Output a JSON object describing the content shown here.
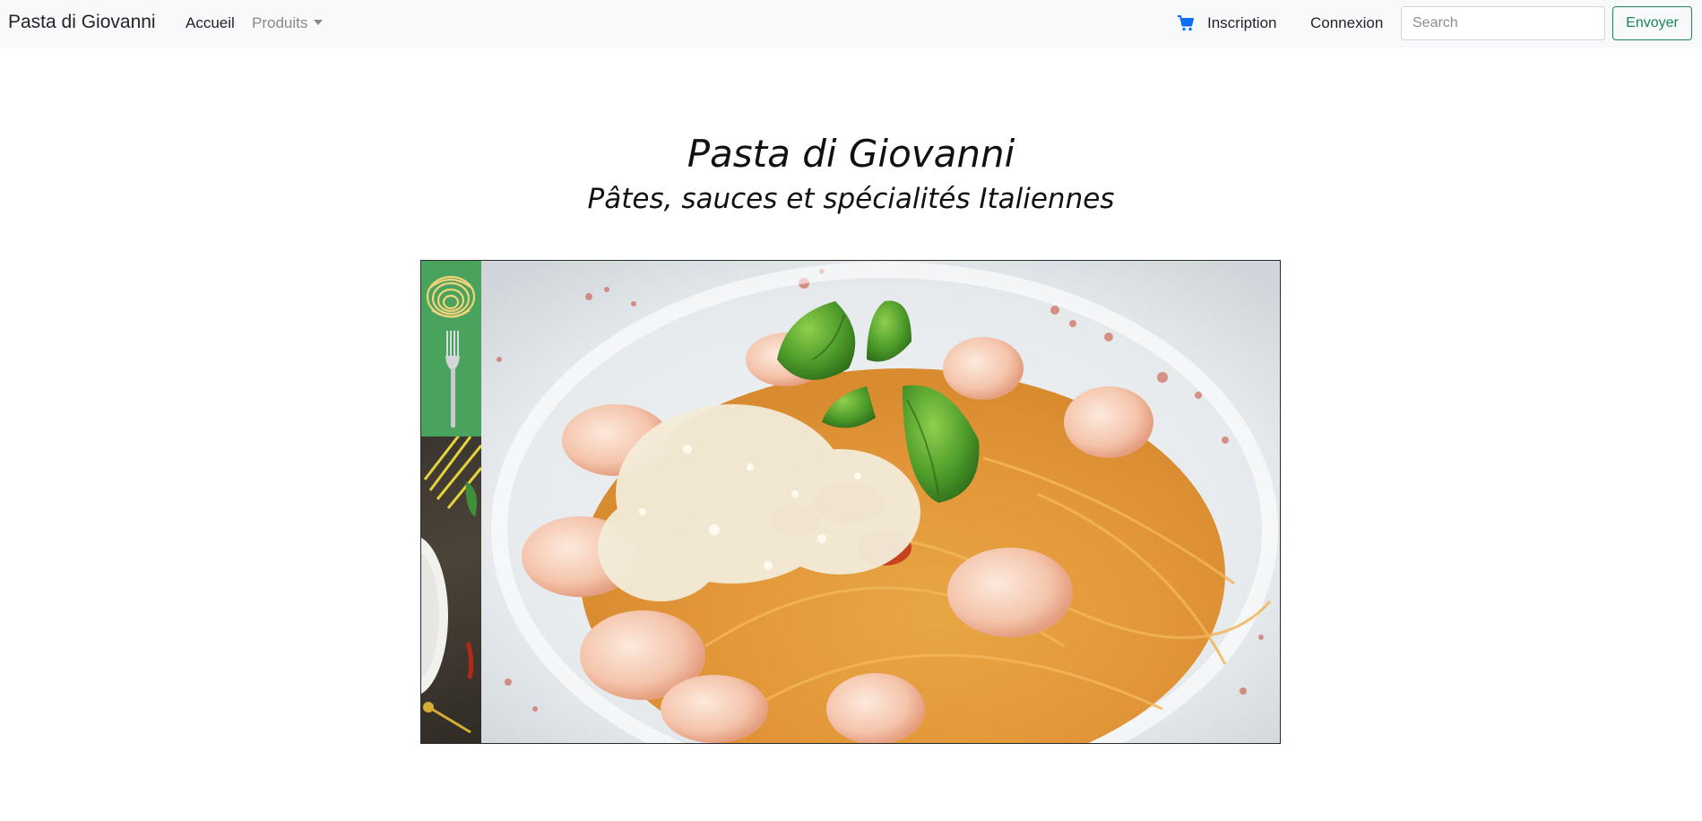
{
  "navbar": {
    "brand": "Pasta di Giovanni",
    "links": {
      "accueil": "Accueil",
      "produits": "Produits"
    },
    "inscription": "Inscription",
    "connexion": "Connexion",
    "search": {
      "placeholder": "Search",
      "value": ""
    },
    "submit_label": "Envoyer",
    "icons": {
      "cart": "shopping-cart-icon",
      "dropdown": "caret-down-icon"
    }
  },
  "hero": {
    "title": "Pasta di Giovanni",
    "subtitle": "Pâtes, sauces et spécialités Italiennes"
  },
  "colors": {
    "navbar_bg": "#f8f9fa",
    "accent_green": "#198754",
    "cart_blue": "#0d6efd",
    "muted_link": "#8a8a8a"
  }
}
